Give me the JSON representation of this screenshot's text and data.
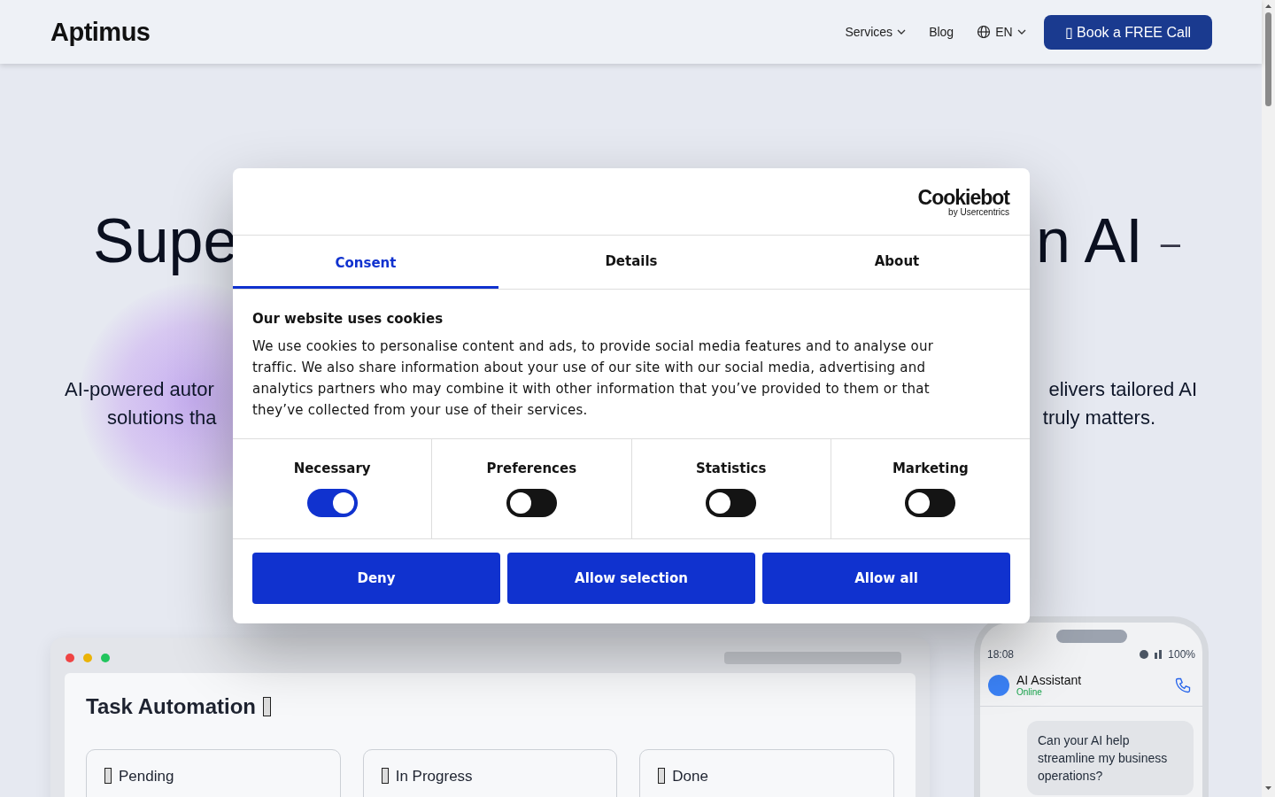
{
  "header": {
    "logo": "Aptimus",
    "nav": [
      {
        "label": "Services",
        "dropdown": true
      },
      {
        "label": "Blog",
        "dropdown": false
      }
    ],
    "language": "EN",
    "cta": {
      "glyph": "▯",
      "label": "Book a FREE Call"
    }
  },
  "hero": {
    "title_left": "Supe",
    "title_right": "n AI",
    "title_dash": "–",
    "lines": [
      {
        "left": "AI-powered autor",
        "right": "elivers tailored AI"
      },
      {
        "left": "solutions tha",
        "right": "truly matters."
      }
    ]
  },
  "task_window": {
    "title": "Task Automation",
    "columns": [
      {
        "label": "Pending"
      },
      {
        "label": "In Progress"
      },
      {
        "label": "Done"
      }
    ]
  },
  "phone": {
    "time": "18:08",
    "battery": "100%",
    "contact": "AI Assistant",
    "status": "Online",
    "messages": [
      "Can your AI help streamline my business operations?"
    ]
  },
  "cookie_dialog": {
    "brand": "Cookiebot",
    "brand_sub": "by Usercentrics",
    "tabs": [
      {
        "label": "Consent",
        "selected": true
      },
      {
        "label": "Details",
        "selected": false
      },
      {
        "label": "About",
        "selected": false
      }
    ],
    "heading": "Our website uses cookies",
    "body": "We use cookies to personalise content and ads, to provide social media features and to analyse our traffic. We also share information about your use of our site with our social media, advertising and analytics partners who may combine it with other information that you’ve provided to them or that they’ve collected from your use of their services.",
    "categories": [
      {
        "label": "Necessary",
        "checked": true
      },
      {
        "label": "Preferences",
        "checked": false
      },
      {
        "label": "Statistics",
        "checked": false
      },
      {
        "label": "Marketing",
        "checked": false
      }
    ],
    "buttons": [
      "Deny",
      "Allow selection",
      "Allow all"
    ]
  }
}
